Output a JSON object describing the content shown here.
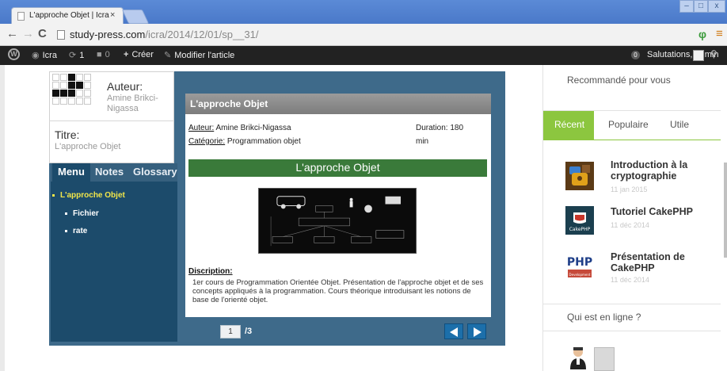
{
  "browser": {
    "tab_title": "L'approche Objet | Icra",
    "tab_close": "×",
    "window_controls": {
      "minimize": "–",
      "maximize": "□",
      "close": "x"
    },
    "url_host": "study-press.com",
    "url_path": "/icra/2014/12/01/sp__31/",
    "nav": {
      "back": "←",
      "forward": "→",
      "reload": "C"
    },
    "icons": {
      "extension": "φ",
      "menu": "≡"
    }
  },
  "admin_bar": {
    "site_name": "Icra",
    "updates_count": "1",
    "comments_count": "0",
    "new_label": "Créer",
    "edit_label": "Modifier l'article",
    "notifications_badge": "0",
    "greeting": "Salutations, admin"
  },
  "course": {
    "author_label": "Auteur:",
    "author_name": "Amine Brikci-Nigassa",
    "title_label": "Titre:",
    "title_value": "L'approche Objet",
    "tabs": [
      "Menu",
      "Notes",
      "Glossary"
    ],
    "menu_items": [
      {
        "label": "L'approche Objet",
        "active": true
      },
      {
        "label": "Fichier",
        "active": false
      },
      {
        "label": "rate",
        "active": false
      }
    ],
    "slide": {
      "header": "L'approche Objet",
      "author_key": "Auteur:",
      "author_value": "Amine Brikci-Nigassa",
      "category_key": "Catégorie:",
      "category_value": "Programmation objet",
      "duration_label": "Duration: 180",
      "duration_unit": "min",
      "banner": "L'approche Objet",
      "description_title": "Discription:",
      "description": "1er cours de Programmation Orientée Objet. Présentation de l'approche objet et de ses concepts appliqués à la programmation. Cours théorique introduisant les notions de base de l'orienté objet."
    },
    "page_current": "1",
    "page_total": "/3"
  },
  "widgets": {
    "recommended_title": "Recommandé pour vous",
    "tabs": [
      "Récent",
      "Populaire",
      "Utile"
    ],
    "posts": [
      {
        "title": "Introduction à la cryptographie",
        "date": "11 jan 2015",
        "thumb": "lock-icon"
      },
      {
        "title": "Tutoriel CakePHP",
        "date": "11 déc 2014",
        "thumb": "cakephp-logo"
      },
      {
        "title": "Présentation de CakePHP",
        "date": "11 déc 2014",
        "thumb": "php-logo"
      }
    ],
    "online_title": "Qui est en ligne ?",
    "php_logo_text": "PHP",
    "cakephp_logo_text": "CakePHP",
    "php_badge_text": "Development"
  },
  "colors": {
    "accent_green": "#8cc63f",
    "player_blue": "#3e6a8a",
    "sidebar_navy": "#1c4b6b",
    "banner_green": "#3a7a3a",
    "active_menu_yellow": "#f1e64a"
  }
}
